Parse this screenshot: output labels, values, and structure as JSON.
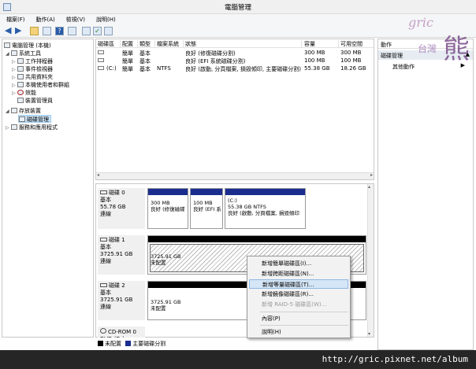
{
  "window": {
    "title": "電腦管理"
  },
  "menu": [
    "檔案(F)",
    "動作(A)",
    "檢視(V)",
    "說明(H)"
  ],
  "tree": {
    "items": [
      {
        "label": "電腦管理 (本機)",
        "indent": 0
      },
      {
        "label": "系統工具",
        "indent": 1
      },
      {
        "label": "工作排程器",
        "indent": 2
      },
      {
        "label": "事件檢視器",
        "indent": 2
      },
      {
        "label": "共用資料夾",
        "indent": 2
      },
      {
        "label": "本機使用者和群組",
        "indent": 2
      },
      {
        "label": "效能",
        "indent": 2
      },
      {
        "label": "裝置管理員",
        "indent": 2
      },
      {
        "label": "存放裝置",
        "indent": 1
      },
      {
        "label": "磁碟管理",
        "indent": 2,
        "selected": true
      },
      {
        "label": "服務和應用程式",
        "indent": 1
      }
    ]
  },
  "volumes": {
    "columns": [
      "磁碟區",
      "配置",
      "類型",
      "檔案系統",
      "狀態",
      "容量",
      "可用空間"
    ],
    "rows": [
      [
        "",
        "簡單",
        "基本",
        "",
        "良好 (修復磁碟分割)",
        "300 MB",
        "300 MB"
      ],
      [
        "",
        "簡單",
        "基本",
        "",
        "良好 (EFI 系統磁碟分割)",
        "100 MB",
        "100 MB"
      ],
      [
        "(C:)",
        "簡單",
        "基本",
        "NTFS",
        "良好 (啟動, 分頁檔案, 損毀傾印, 主要磁碟分割)",
        "55.38 GB",
        "18.26 GB"
      ]
    ]
  },
  "disks": [
    {
      "name": "磁碟 0",
      "type": "基本",
      "size": "55.78 GB",
      "status": "連線",
      "partitions": [
        {
          "size": "300 MB",
          "desc": "良好 (修復磁碟",
          "label": ""
        },
        {
          "size": "100 MB",
          "desc": "良好 (EFI 系",
          "label": ""
        },
        {
          "size": "55.38 GB NTFS",
          "desc": "良好 (啟動, 分頁檔案, 損毀傾印",
          "label": "(C:)"
        }
      ]
    },
    {
      "name": "磁碟 1",
      "type": "基本",
      "size": "3725.91 GB",
      "status": "連線",
      "partitions": [
        {
          "size": "3725.91 GB",
          "desc": "未配置",
          "label": ""
        }
      ]
    },
    {
      "name": "磁碟 2",
      "type": "基本",
      "size": "3725.91 GB",
      "status": "連線",
      "partitions": [
        {
          "size": "3725.91 GB",
          "desc": "未配置",
          "label": ""
        }
      ]
    },
    {
      "name": "CD-ROM 0",
      "type": "DVD (D:)",
      "size": "",
      "status": ""
    }
  ],
  "legend": [
    "未配置",
    "主要磁碟分割"
  ],
  "actions": {
    "header": "動作",
    "section": "磁碟管理",
    "more": "其他動作"
  },
  "context_menu": {
    "items": [
      {
        "label": "新增簡單磁碟區(I)...",
        "disabled": false
      },
      {
        "label": "新增跨距磁碟區(N)...",
        "disabled": false
      },
      {
        "label": "新增等量磁碟區(T)...",
        "disabled": false,
        "highlighted": true
      },
      {
        "label": "新增鏡像磁碟區(R)...",
        "disabled": false
      },
      {
        "label": "新增 RAID-5 磁碟區(W)...",
        "disabled": true
      },
      {
        "label": "內容(P)",
        "disabled": false
      },
      {
        "label": "說明(H)",
        "disabled": false
      }
    ]
  },
  "watermark": {
    "logo": "gric 台灣 熊",
    "url": "http://gric.pixnet.net/album"
  },
  "colors": {
    "primary_partition": "#1a2d8f",
    "unallocated": "#000000",
    "menu_highlight": "#d5e6f7"
  }
}
